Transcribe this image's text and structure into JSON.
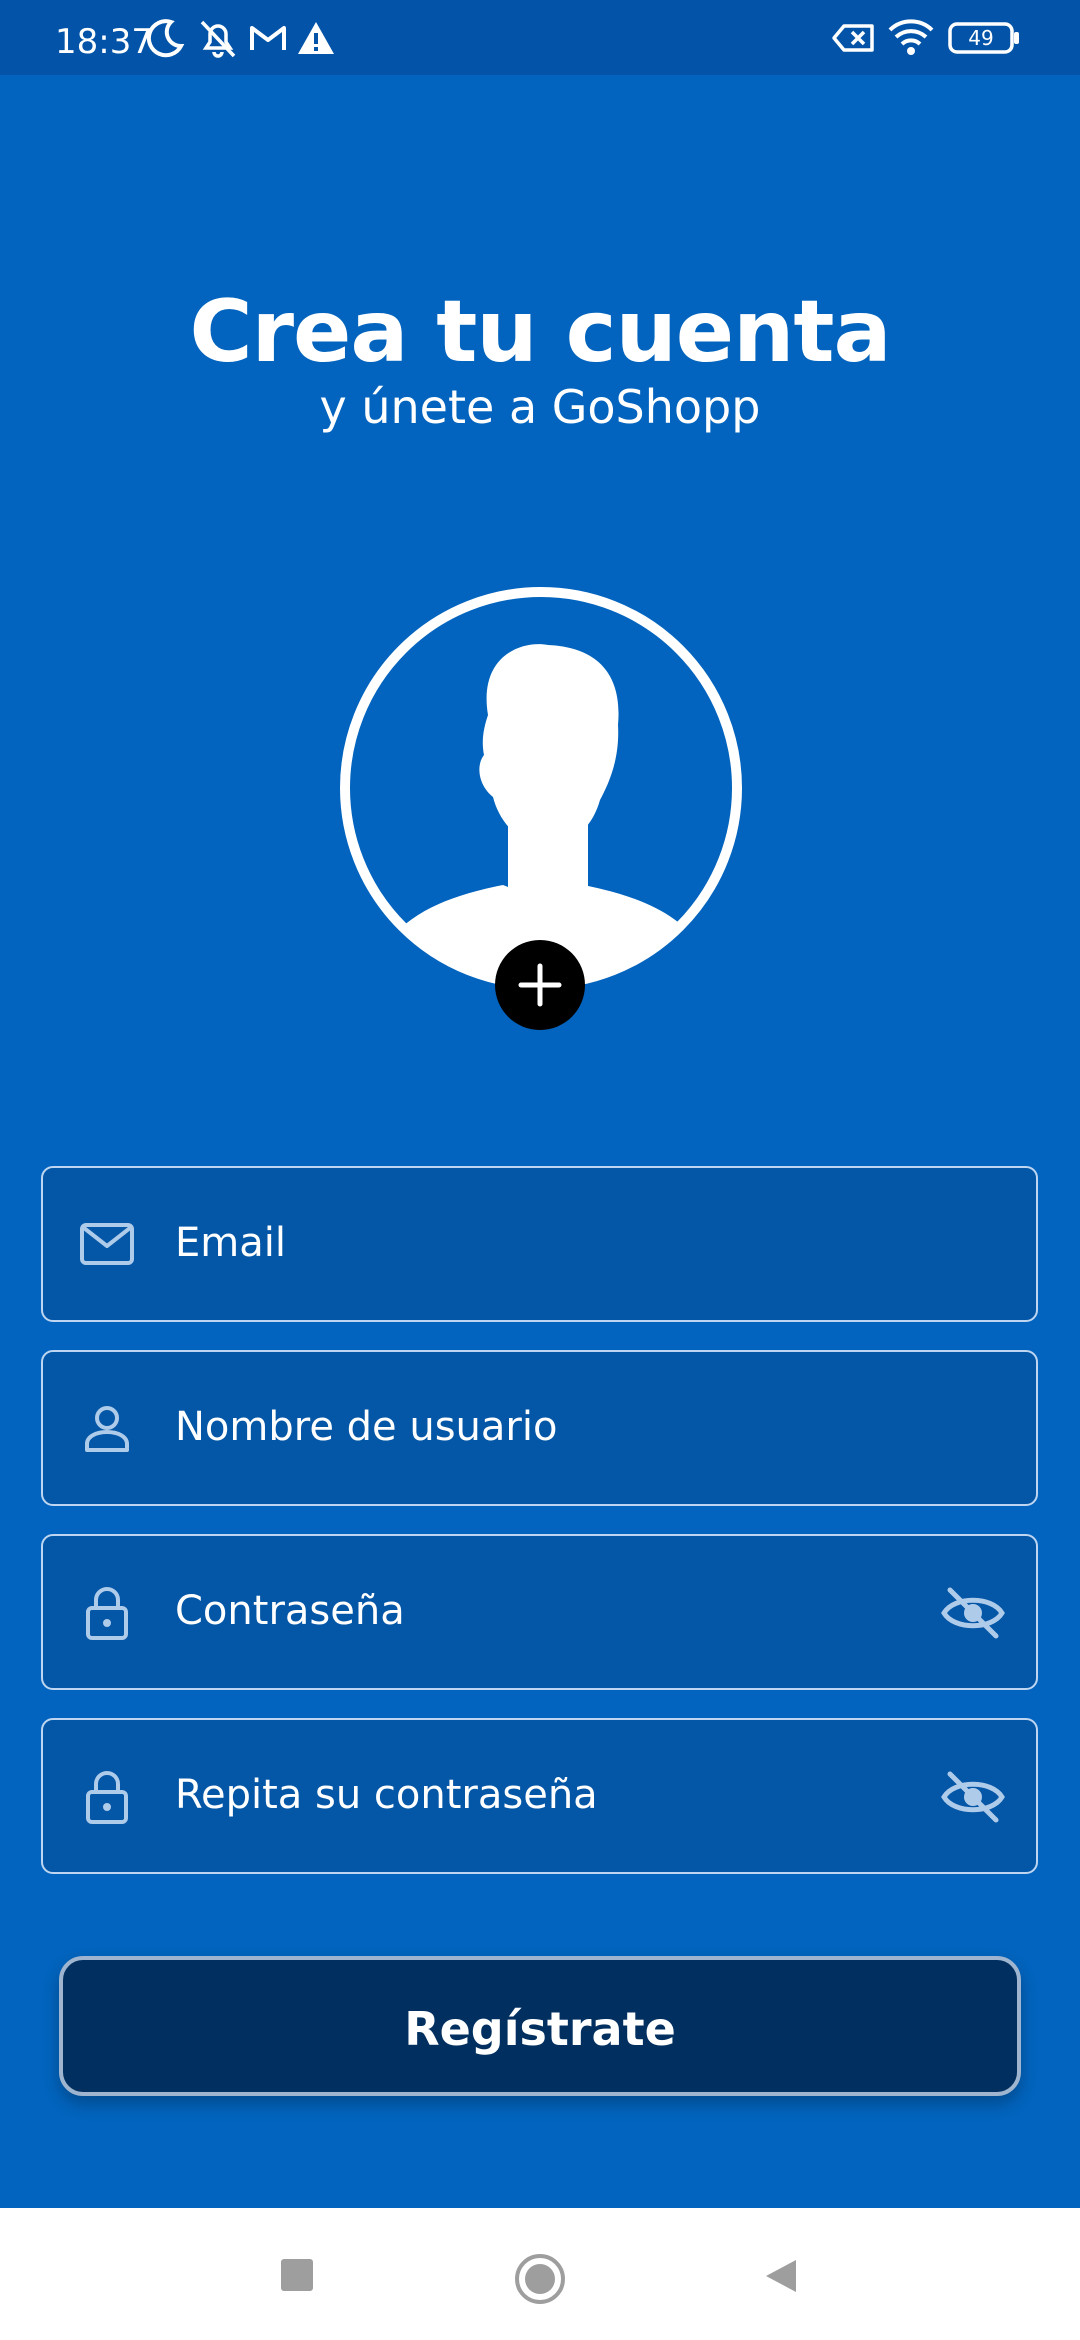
{
  "status_bar": {
    "time": "18:37",
    "battery": "49",
    "icons": [
      "moon-icon",
      "bell-off-icon",
      "gmail-icon",
      "warning-icon",
      "sim-off-icon",
      "wifi-icon",
      "battery-icon"
    ]
  },
  "header": {
    "title": "Crea tu cuenta",
    "subtitle": "y únete a GoShopp"
  },
  "avatar": {
    "icon": "person-silhouette-icon",
    "add_icon": "plus-icon"
  },
  "form": {
    "email": {
      "label": "Email",
      "icon": "mail-icon"
    },
    "username": {
      "label": "Nombre de usuario",
      "icon": "person-icon"
    },
    "password": {
      "label": "Contraseña",
      "icon": "lock-icon",
      "toggle_icon": "eye-off-icon"
    },
    "password_repeat": {
      "label": "Repita su contraseña",
      "icon": "lock-icon",
      "toggle_icon": "eye-off-icon"
    }
  },
  "register_button": {
    "label": "Regístrate"
  },
  "nav_bar": {
    "buttons": [
      "recents-button",
      "home-button",
      "back-button"
    ]
  },
  "colors": {
    "background": "#0264BE",
    "status_bar": "#0354A8",
    "field_bg": "#0456A6",
    "field_border": "#BFD6F2",
    "button_bg": "#012F5F",
    "icon_tint": "#AFCBEA"
  }
}
